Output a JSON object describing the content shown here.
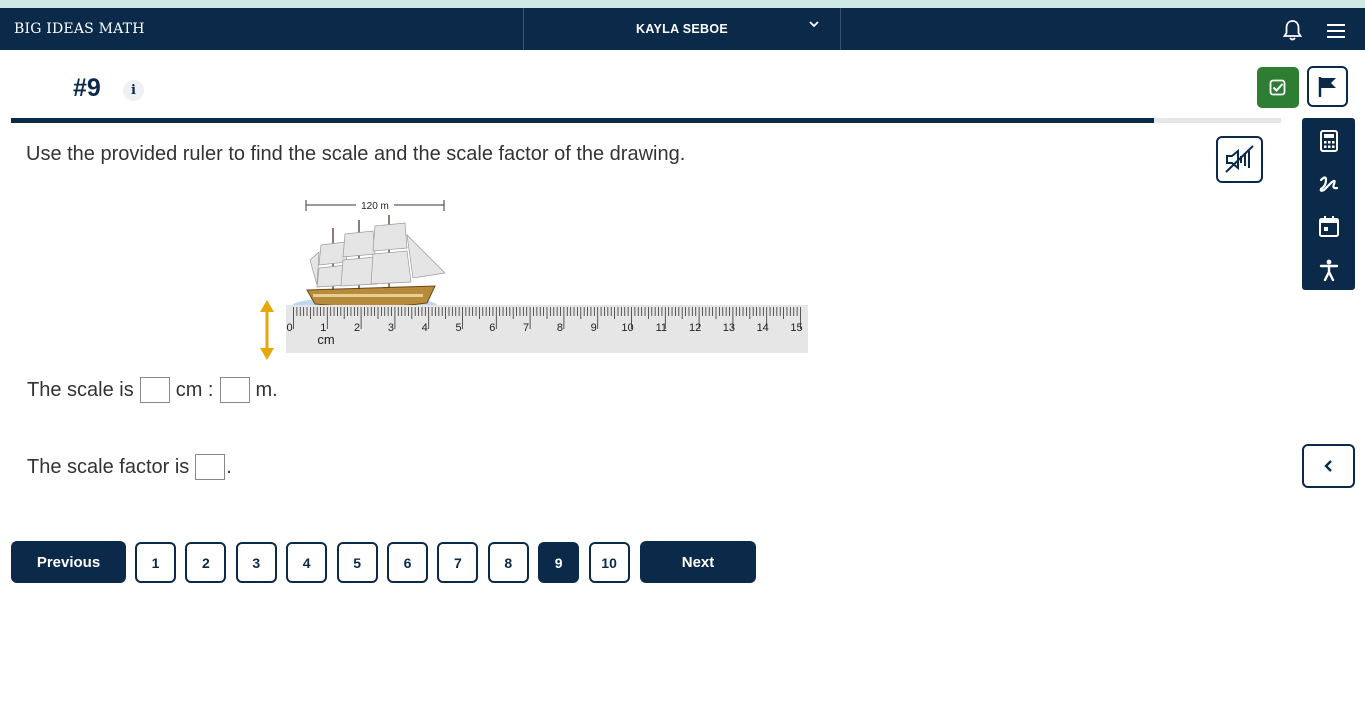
{
  "header": {
    "brand": "BIG IDEAS MATH",
    "user": "KAYLA SEBOE",
    "icons": [
      "chevron-down-icon",
      "bell-icon",
      "menu-icon"
    ]
  },
  "question": {
    "number": "#9",
    "info_label": "i",
    "prompt": "Use the provided ruler to find the scale and the scale factor of the drawing.",
    "progress_fraction": 0.9
  },
  "figure": {
    "dimension_label": "120 m",
    "ruler_unit": "cm",
    "ruler_numbers": [
      "0",
      "1",
      "2",
      "3",
      "4",
      "5",
      "6",
      "7",
      "8",
      "9",
      "10",
      "11",
      "12",
      "13",
      "14",
      "15"
    ]
  },
  "answers": {
    "scale_prefix": "The scale is",
    "scale_mid": "cm :",
    "scale_suffix": "m.",
    "factor_prefix": "The scale factor is",
    "factor_suffix": "."
  },
  "tools": [
    "calculator-icon",
    "sketch-icon",
    "calendar-icon",
    "accessibility-icon"
  ],
  "pagination": {
    "previous": "Previous",
    "next": "Next",
    "pages": [
      "1",
      "2",
      "3",
      "4",
      "5",
      "6",
      "7",
      "8",
      "9",
      "10"
    ],
    "current": "9"
  },
  "colors": {
    "navy": "#0b2a4a",
    "green": "#2d7d32",
    "accent_strip": "#cfeae3"
  }
}
